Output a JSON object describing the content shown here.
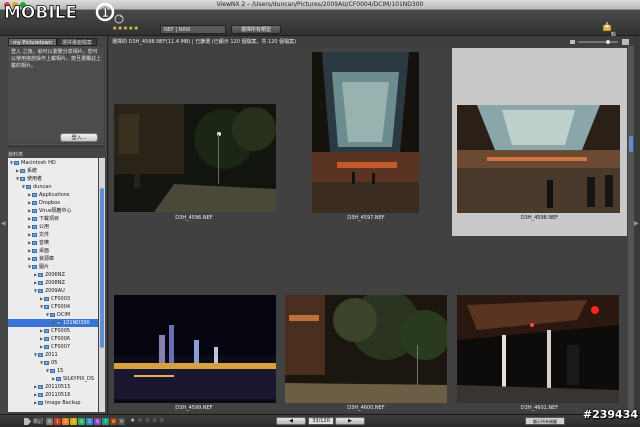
{
  "window": {
    "title": "ViewNX 2 – /Users/duncan/Pictures/2009AU/CF0004/DCIM/101ND300"
  },
  "watermark": {
    "logo_text": "MOBILE01",
    "id": "#239434"
  },
  "toolbar": {
    "rating_stars": "★★★★★",
    "format_select": "NEF | NRW",
    "view_button": "選擇所有類型",
    "right_label": "輸"
  },
  "left_panel": {
    "tabs": [
      "my Picturetown",
      "選擇畫面檔案"
    ],
    "login_text": "登入 之後，就可以瀏覽分享相片。您可以使用拖放操作上載相片。按旦選獨註上載的相片。",
    "login_button": "登入...",
    "folders_label": "資料夾",
    "tree": [
      {
        "label": "Macintosh HD",
        "depth": 0,
        "expanded": true
      },
      {
        "label": "系統",
        "depth": 1,
        "expanded": false
      },
      {
        "label": "使用者",
        "depth": 1,
        "expanded": true
      },
      {
        "label": "duncan",
        "depth": 2,
        "expanded": true
      },
      {
        "label": "Applications",
        "depth": 3,
        "expanded": false
      },
      {
        "label": "Dropbox",
        "depth": 3,
        "expanded": false
      },
      {
        "label": "Virus隔離中心",
        "depth": 3,
        "expanded": false
      },
      {
        "label": "下載項目",
        "depth": 3,
        "expanded": false
      },
      {
        "label": "公用",
        "depth": 3,
        "expanded": false
      },
      {
        "label": "文件",
        "depth": 3,
        "expanded": false
      },
      {
        "label": "音樂",
        "depth": 3,
        "expanded": false
      },
      {
        "label": "桌面",
        "depth": 3,
        "expanded": false
      },
      {
        "label": "資源庫",
        "depth": 3,
        "expanded": false
      },
      {
        "label": "圖片",
        "depth": 3,
        "expanded": true
      },
      {
        "label": "2006NZ",
        "depth": 4,
        "expanded": false
      },
      {
        "label": "2008NZ",
        "depth": 4,
        "expanded": false
      },
      {
        "label": "2009AU",
        "depth": 4,
        "expanded": true
      },
      {
        "label": "CF0003",
        "depth": 5,
        "expanded": false
      },
      {
        "label": "CF0004",
        "depth": 5,
        "expanded": true
      },
      {
        "label": "DCIM",
        "depth": 6,
        "expanded": true
      },
      {
        "label": "101ND300",
        "depth": 7,
        "expanded": false,
        "selected": true
      },
      {
        "label": "CF0005",
        "depth": 5,
        "expanded": false
      },
      {
        "label": "CF0006",
        "depth": 5,
        "expanded": false
      },
      {
        "label": "CF0007",
        "depth": 5,
        "expanded": false
      },
      {
        "label": "2011",
        "depth": 4,
        "expanded": true
      },
      {
        "label": "05",
        "depth": 5,
        "expanded": true
      },
      {
        "label": "15",
        "depth": 6,
        "expanded": true
      },
      {
        "label": "SILKYPIX_DS",
        "depth": 7,
        "expanded": false
      },
      {
        "label": "20110515",
        "depth": 4,
        "expanded": false
      },
      {
        "label": "20110516",
        "depth": 4,
        "expanded": false
      },
      {
        "label": "Image Backup",
        "depth": 4,
        "expanded": false
      }
    ]
  },
  "main": {
    "selection_info": "選擇的 D3H_4598.NEF(11.4 MB) | 已篩選 (已顯示 120 個檔案，共 120 個檔案)",
    "thumbnails": [
      {
        "filename": "D3H_4596.NEF",
        "selected": false
      },
      {
        "filename": "D3H_4597.NEF",
        "selected": false
      },
      {
        "filename": "D3H_4598.NEF",
        "selected": true
      },
      {
        "filename": "D3H_4599.NEF",
        "selected": false
      },
      {
        "filename": "D3H_4600.NEF",
        "selected": false
      },
      {
        "filename": "D3H_4601.NEF",
        "selected": false
      }
    ]
  },
  "status_bar": {
    "label_title": "標記",
    "labels": [
      "0",
      "1",
      "2",
      "3",
      "4",
      "5",
      "6",
      "7",
      "8",
      "9"
    ],
    "label_colors": [
      "#777777",
      "#c0392b",
      "#e67e22",
      "#d4ac0d",
      "#27ae60",
      "#2e86c1",
      "#8e44ad",
      "#16a085",
      "#a04000",
      "#555555"
    ],
    "rating": "★ ☆ ☆ ☆ ☆",
    "prev": "◀",
    "next": "▶",
    "page_counter": "33/120",
    "right_button": "顯示所有縮圖"
  }
}
